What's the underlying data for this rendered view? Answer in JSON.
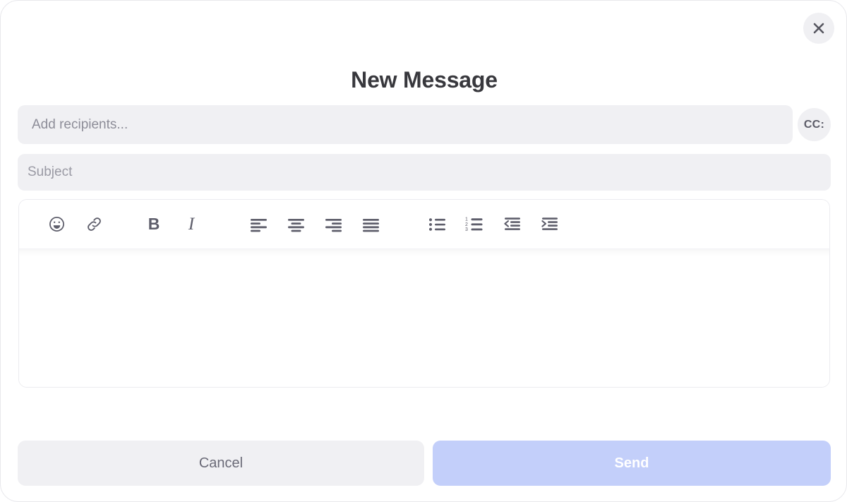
{
  "modal": {
    "title": "New Message",
    "close_icon": "close-icon",
    "close_label": "Close"
  },
  "recipients": {
    "value": "",
    "placeholder": "Add recipients...",
    "cc_label": "CC:"
  },
  "subject": {
    "value": "",
    "placeholder": "Subject"
  },
  "editor": {
    "body_value": "",
    "body_placeholder": "",
    "toolbar": [
      {
        "name": "emoji-icon",
        "label": "Emoji"
      },
      {
        "name": "link-icon",
        "label": "Insert link"
      },
      {
        "name": "bold-icon",
        "label": "B"
      },
      {
        "name": "italic-icon",
        "label": "I"
      },
      {
        "name": "align-left-icon",
        "label": "Align left"
      },
      {
        "name": "align-center-icon",
        "label": "Align center"
      },
      {
        "name": "align-right-icon",
        "label": "Align right"
      },
      {
        "name": "align-justify-icon",
        "label": "Justify"
      },
      {
        "name": "bullet-list-icon",
        "label": "Bulleted list"
      },
      {
        "name": "numbered-list-icon",
        "label": "Numbered list"
      },
      {
        "name": "outdent-icon",
        "label": "Decrease indent"
      },
      {
        "name": "indent-icon",
        "label": "Increase indent"
      }
    ],
    "numbered_list_digits": [
      "1",
      "2",
      "3"
    ]
  },
  "footer": {
    "cancel_label": "Cancel",
    "send_label": "Send"
  },
  "colors": {
    "accent": "#c3cffa",
    "field_bg": "#f0f0f3",
    "icon": "#5e5e6b",
    "title_text": "#38383d",
    "placeholder": "#8d8d98",
    "send_text": "#ffffff"
  }
}
